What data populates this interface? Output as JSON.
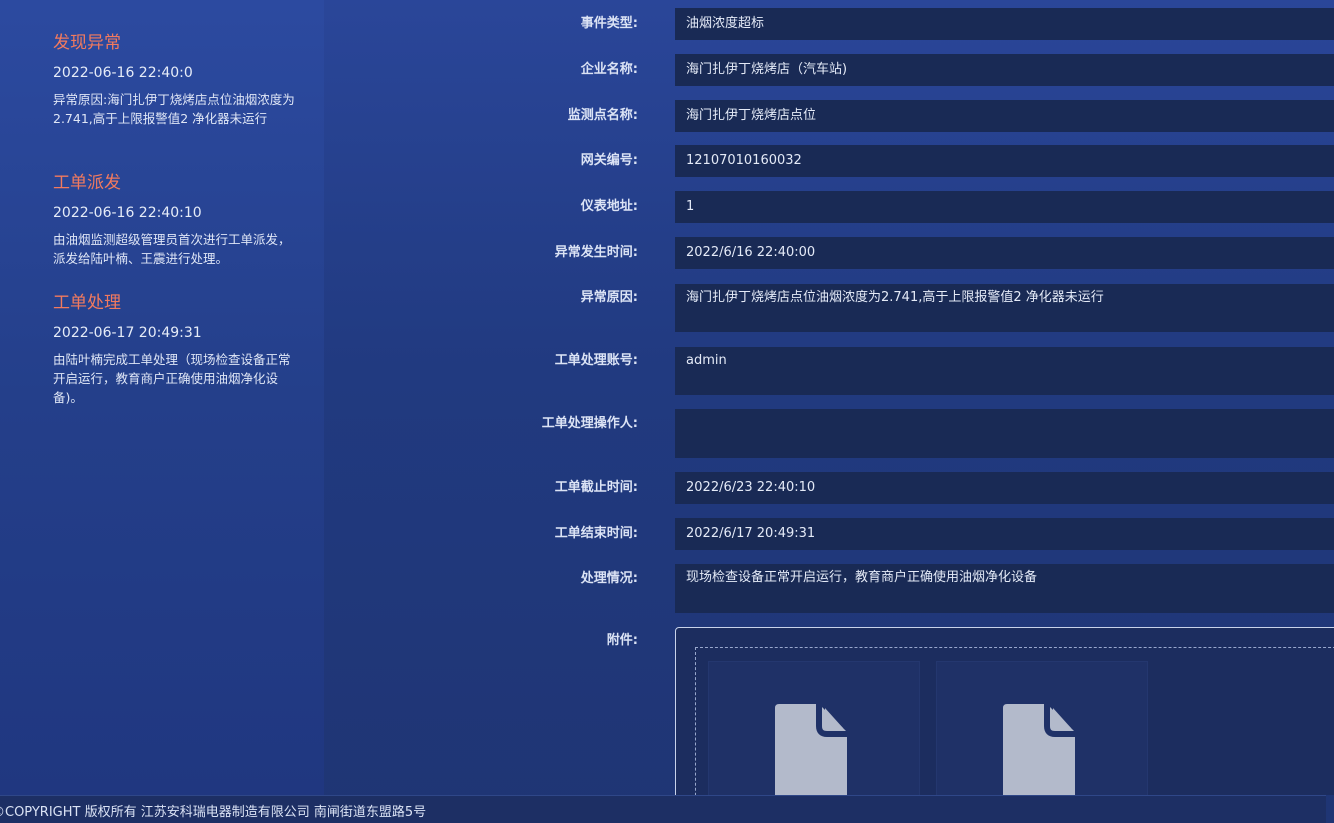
{
  "timeline": [
    {
      "title": "发现异常",
      "time": "2022-06-16 22:40:0",
      "desc": "异常原因:海门扎伊丁烧烤店点位油烟浓度为2.741,高于上限报警值2 净化器未运行"
    },
    {
      "title": "工单派发",
      "time": "2022-06-16 22:40:10",
      "desc": "由油烟监测超级管理员首次进行工单派发，派发给陆叶楠、王震进行处理。"
    },
    {
      "title": "工单处理",
      "time": "2022-06-17 20:49:31",
      "desc": "由陆叶楠完成工单处理（现场检查设备正常开启运行，教育商户正确使用油烟净化设备)。"
    }
  ],
  "form": {
    "fields": [
      {
        "label": "事件类型:",
        "value": "油烟浓度超标"
      },
      {
        "label": "企业名称:",
        "value": "海门扎伊丁烧烤店（汽车站)"
      },
      {
        "label": "监测点名称:",
        "value": "海门扎伊丁烧烤店点位"
      },
      {
        "label": "网关编号:",
        "value": "12107010160032"
      },
      {
        "label": "仪表地址:",
        "value": "1"
      },
      {
        "label": "异常发生时间:",
        "value": "2022/6/16 22:40:00"
      },
      {
        "label": "异常原因:",
        "value": "海门扎伊丁烧烤店点位油烟浓度为2.741,高于上限报警值2 净化器未运行"
      },
      {
        "label": "工单处理账号:",
        "value": "admin"
      },
      {
        "label": "工单处理操作人:",
        "value": ""
      },
      {
        "label": "工单截止时间:",
        "value": "2022/6/23 22:40:10"
      },
      {
        "label": "工单结束时间:",
        "value": "2022/6/17 20:49:31"
      },
      {
        "label": "处理情况:",
        "value": "现场检查设备正常开启运行，教育商户正确使用油烟净化设备"
      }
    ],
    "attachment_label": "附件:",
    "attachments": [
      {
        "icon": "file-icon"
      },
      {
        "icon": "file-icon"
      }
    ]
  },
  "footer": {
    "text": "©COPYRIGHT 版权所有 江苏安科瑞电器制造有限公司 南闸街道东盟路5号"
  },
  "colors": {
    "accent_title": "#f27a5e",
    "field_bg": "#192a55",
    "background": "#213a80"
  }
}
